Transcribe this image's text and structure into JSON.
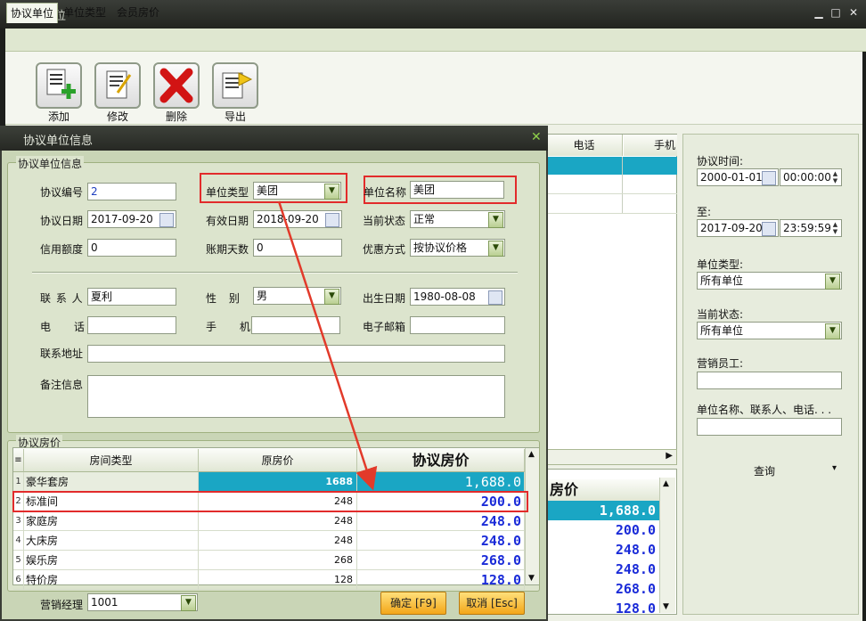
{
  "window": {
    "title": "协议单位",
    "min": "▁",
    "max": "□",
    "close": "✕"
  },
  "tabs": [
    "协议单位",
    "单位类型",
    "会员房价"
  ],
  "toolbar": {
    "add": "添加",
    "edit": "修改",
    "delete": "删除",
    "export": "导出"
  },
  "bg_grid": {
    "headers": [
      "电话",
      "手机"
    ],
    "agreed_header": "房价",
    "agreed_values": [
      "1,688.0",
      "200.0",
      "248.0",
      "248.0",
      "268.0",
      "128.0"
    ]
  },
  "filters": {
    "time_label": "协议时间:",
    "from_date": "2000-01-01",
    "from_time": "00:00:00",
    "to_label": "至:",
    "to_date": "2017-09-20",
    "to_time": "23:59:59",
    "type_label": "单位类型:",
    "type_value": "所有单位",
    "status_label": "当前状态:",
    "status_value": "所有单位",
    "staff_label": "营销员工:",
    "staff_value": "",
    "keyword_label": "单位名称、联系人、电话. . .",
    "keyword_value": "",
    "query_button": "查询",
    "query_arrow": "▾"
  },
  "dialog": {
    "title": "协议单位信息",
    "close": "✕",
    "group_info": "协议单位信息",
    "code_label": "协议编号",
    "code_value": "2",
    "unit_type_label": "单位类型",
    "unit_type_value": "美团",
    "unit_name_label": "单位名称",
    "unit_name_value": "美团",
    "date_label": "协议日期",
    "date_value": "2017-09-20",
    "valid_label": "有效日期",
    "valid_value": "2018-09-20",
    "status_label": "当前状态",
    "status_value": "正常",
    "credit_label": "信用额度",
    "credit_value": "0",
    "period_label": "账期天数",
    "period_value": "0",
    "discount_label": "优惠方式",
    "discount_value": "按协议价格",
    "contact_label": "联 系 人",
    "contact_value": "夏利",
    "gender_label": "性 别",
    "gender_value": "男",
    "birth_label": "出生日期",
    "birth_value": "1980-08-08",
    "phone_label": "电 话",
    "phone_value": "",
    "mobile_label": "手 机",
    "mobile_value": "",
    "email_label": "电子邮箱",
    "email_value": "",
    "address_label": "联系地址",
    "address_value": "",
    "remark_label": "备注信息",
    "remark_value": "",
    "group_price": "协议房价",
    "manager_label": "营销经理",
    "manager_value": "1001",
    "ok_button": "确定 [F9]",
    "cancel_button": "取消 [Esc]"
  },
  "price_grid": {
    "headers": {
      "corner": "≡",
      "room_type": "房间类型",
      "orig": "原房价",
      "agreed": "协议房价"
    },
    "rows": [
      {
        "n": "1",
        "type": "豪华套房",
        "orig": "1688",
        "agreed": "1,688.0"
      },
      {
        "n": "2",
        "type": "标准间",
        "orig": "248",
        "agreed": "200.0"
      },
      {
        "n": "3",
        "type": "家庭房",
        "orig": "248",
        "agreed": "248.0"
      },
      {
        "n": "4",
        "type": "大床房",
        "orig": "248",
        "agreed": "248.0"
      },
      {
        "n": "5",
        "type": "娱乐房",
        "orig": "268",
        "agreed": "268.0"
      },
      {
        "n": "6",
        "type": "特价房",
        "orig": "128",
        "agreed": "128.0"
      }
    ]
  },
  "colors": {
    "selected_row": "#1aa6c4",
    "highlight": "#e22b2b",
    "agreed_text": "#1a2bd8"
  }
}
